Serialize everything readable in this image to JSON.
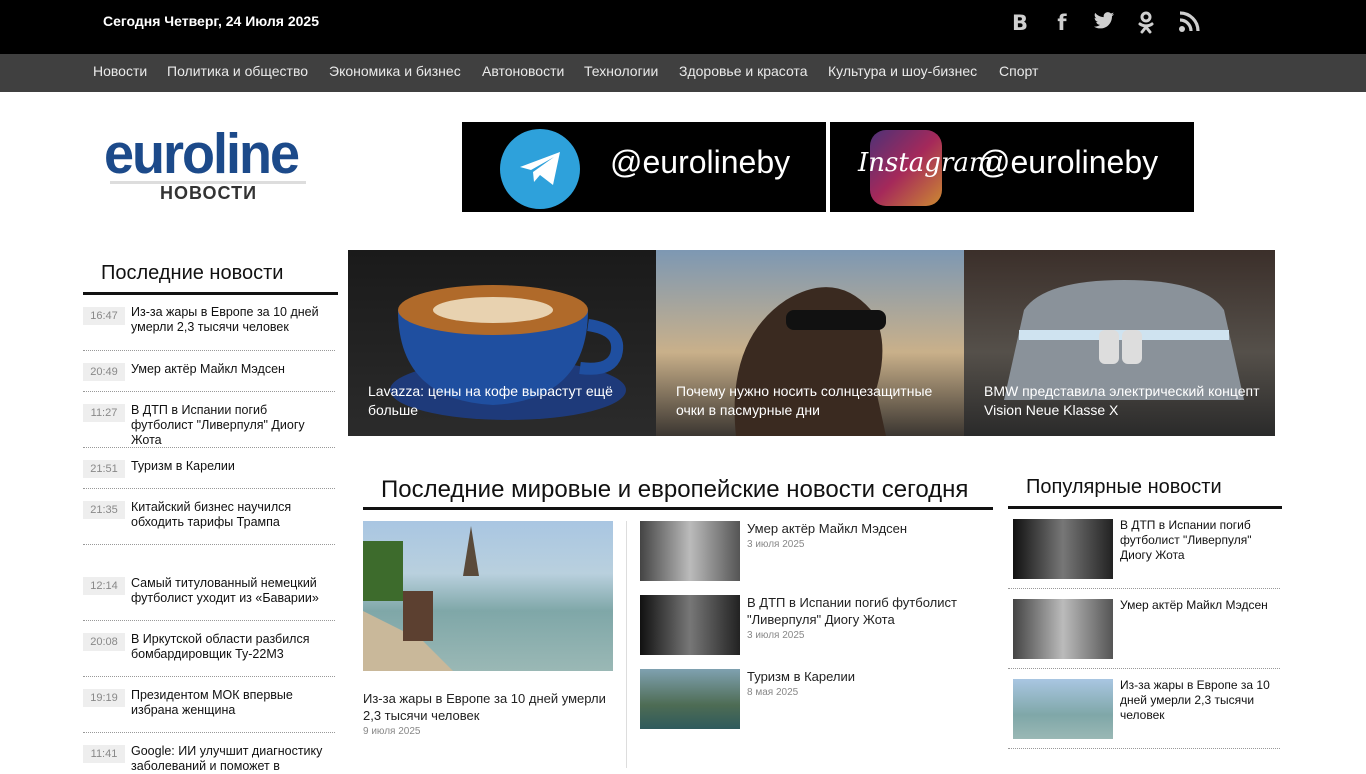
{
  "topbar": {
    "date": "Сегодня Четверг, 24 Июля 2025",
    "social_icons": [
      "vk-icon",
      "facebook-icon",
      "twitter-icon",
      "odnoklassniki-icon",
      "rss-icon"
    ]
  },
  "nav": {
    "items": [
      "Новости",
      "Политика и общество",
      "Экономика и бизнес",
      "Автоновости",
      "Технологии",
      "Здоровье и красота",
      "Культура и шоу-бизнес",
      "Спорт"
    ]
  },
  "logo": {
    "main": "euroline",
    "sub": "НОВОСТИ"
  },
  "banners": [
    {
      "network": "Telegram",
      "handle": "@eurolineby"
    },
    {
      "network": "Instagram",
      "handle": "@eurolineby",
      "label": "Instagram"
    }
  ],
  "latest": {
    "title": "Последние новости",
    "items": [
      {
        "time": "16:47",
        "text": "Из-за жары в Европе за 10 дней умерли 2,3 тысячи человек"
      },
      {
        "time": "20:49",
        "text": "Умер актёр Майкл Мэдсен"
      },
      {
        "time": "11:27",
        "text": "В ДТП в Испании погиб футболист \"Ливерпуля\" Диогу Жота"
      },
      {
        "time": "21:51",
        "text": "Туризм в Карелии"
      },
      {
        "time": "21:35",
        "text": "Китайский бизнес научился обходить тарифы Трампа"
      },
      {
        "time": "12:14",
        "text": "Самый титулованный немецкий футболист уходит из «Баварии»"
      },
      {
        "time": "20:08",
        "text": "В Иркутской области разбился бомбардировщик Ту-22М3"
      },
      {
        "time": "19:19",
        "text": "Президентом МОК впервые избрана женщина"
      },
      {
        "time": "11:41",
        "text": "Google: ИИ улучшит диагностику заболеваний и поможет в"
      }
    ]
  },
  "slider": [
    {
      "caption": "Lavazza: цены на кофе вырастут ещё больше"
    },
    {
      "caption": "Почему нужно носить солнцезащитные очки в пасмурные дни"
    },
    {
      "caption": "BMW представила электрический концепт Vision Neue Klasse X"
    }
  ],
  "world": {
    "title": "Последние мировые и европейские новости сегодня",
    "lead": {
      "title": "Из-за жары в Европе за 10 дней умерли 2,3 тысячи человек",
      "date": "9 июля 2025"
    },
    "items": [
      {
        "title": "Умер актёр Майкл Мэдсен",
        "date": "3 июля 2025"
      },
      {
        "title": "В ДТП в Испании погиб футболист \"Ливерпуля\" Диогу Жота",
        "date": "3 июля 2025"
      },
      {
        "title": "Туризм в Карелии",
        "date": "8 мая 2025"
      }
    ]
  },
  "popular": {
    "title": "Популярные новости",
    "items": [
      {
        "title": "В ДТП в Испании погиб футболист \"Ливерпуля\" Диогу Жота"
      },
      {
        "title": "Умер актёр Майкл Мэдсен"
      },
      {
        "title": "Из-за жары в Европе за 10 дней умерли 2,3 тысячи человек"
      }
    ]
  }
}
